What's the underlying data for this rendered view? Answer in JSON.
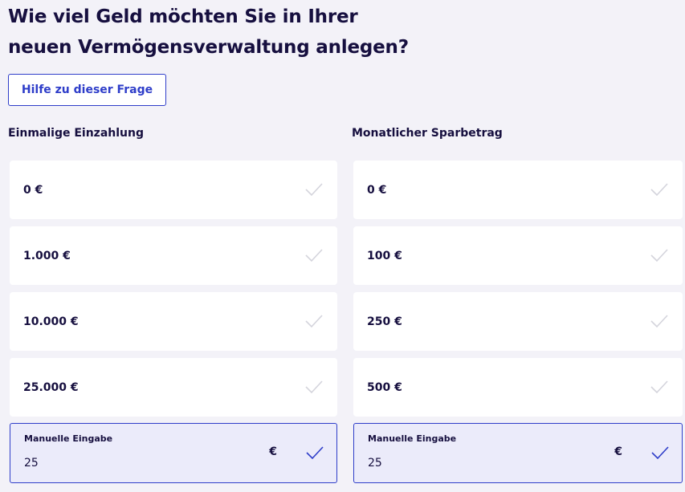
{
  "question": {
    "line1": "Wie viel Geld möchten Sie in Ihrer",
    "line2": "neuen Vermögensverwaltung anlegen?"
  },
  "help_button": "Hilfe zu dieser Frage",
  "one_time": {
    "label": "Einmalige Einzahlung",
    "options": [
      "0 €",
      "1.000 €",
      "10.000 €",
      "25.000 €"
    ],
    "manual": {
      "label": "Manuelle Eingabe",
      "value": "25",
      "currency": "€"
    }
  },
  "monthly": {
    "label": "Monatlicher Sparbetrag",
    "options": [
      "0 €",
      "100 €",
      "250 €",
      "500 €"
    ],
    "manual": {
      "label": "Manuelle Eingabe",
      "value": "25",
      "currency": "€"
    }
  },
  "colors": {
    "background": "#f3f2f8",
    "text": "#160f3f",
    "accent": "#2e3dc9",
    "check_inactive": "#d4d4dc",
    "manual_bg": "#ebebfa"
  },
  "icons": {
    "option_check": "checkmark-icon",
    "manual_check": "checkmark-icon"
  }
}
